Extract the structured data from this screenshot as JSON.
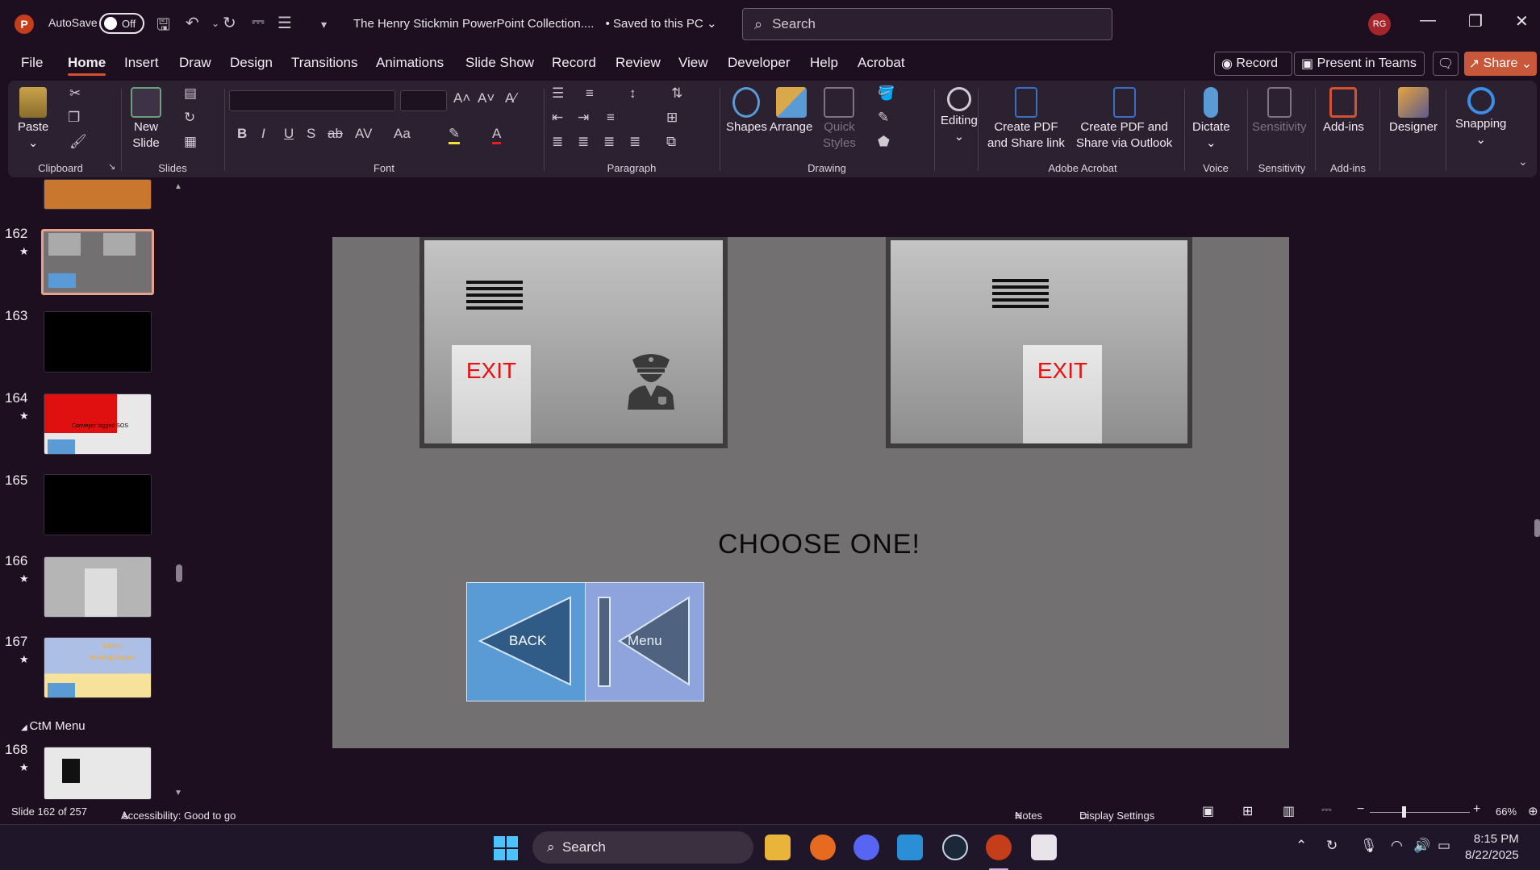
{
  "titlebar": {
    "app_icon_letter": "P",
    "autosave_label": "AutoSave",
    "autosave_state": "Off",
    "doc_title": "The Henry Stickmin PowerPoint Collection....",
    "saved_status": "• Saved to this PC",
    "search_placeholder": "Search",
    "avatar_initials": "RG"
  },
  "menu": {
    "tabs": [
      "File",
      "Home",
      "Insert",
      "Draw",
      "Design",
      "Transitions",
      "Animations",
      "Slide Show",
      "Record",
      "Review",
      "View",
      "Developer",
      "Help",
      "Acrobat"
    ],
    "active_tab": "Home",
    "record_label": "Record",
    "present_label": "Present in Teams",
    "share_label": "Share"
  },
  "ribbon": {
    "clipboard": {
      "paste": "Paste",
      "group": "Clipboard"
    },
    "slides": {
      "new_slide_1": "New",
      "new_slide_2": "Slide",
      "group": "Slides"
    },
    "font": {
      "group": "Font",
      "bold": "B",
      "italic": "I",
      "underline": "U",
      "shadow": "S",
      "strike": "ab",
      "spacing": "AV",
      "case": "Aa"
    },
    "paragraph": {
      "group": "Paragraph"
    },
    "drawing": {
      "shapes": "Shapes",
      "arrange": "Arrange",
      "quick_styles_1": "Quick",
      "quick_styles_2": "Styles",
      "group": "Drawing"
    },
    "editing": {
      "label": "Editing"
    },
    "acrobat": {
      "create_link_1": "Create PDF",
      "create_link_2": "and Share link",
      "create_outlook_1": "Create PDF and",
      "create_outlook_2": "Share via Outlook",
      "group": "Adobe Acrobat"
    },
    "voice": {
      "dictate": "Dictate",
      "group": "Voice"
    },
    "sensitivity": {
      "label": "Sensitivity",
      "group": "Sensitivity"
    },
    "addins": {
      "label": "Add-ins",
      "group": "Add-ins"
    },
    "designer": {
      "label": "Designer"
    },
    "snapping": {
      "label": "Snapping"
    }
  },
  "slide_pane": {
    "slides": [
      {
        "num": "162",
        "star": "★"
      },
      {
        "num": "163",
        "star": ""
      },
      {
        "num": "164",
        "star": "★"
      },
      {
        "num": "165",
        "star": ""
      },
      {
        "num": "166",
        "star": "★"
      },
      {
        "num": "167",
        "star": "★"
      },
      {
        "num": "168",
        "star": "★"
      }
    ],
    "thumb_164_text": "Conveyor tagged SOS",
    "thumb_167_rank": "RANK:",
    "thumb_167_title": "Venting Expert",
    "section_label": "CtM Menu"
  },
  "slide": {
    "exit_left": "EXIT",
    "exit_right": "EXIT",
    "choose": "CHOOSE ONE!",
    "back_label": "BACK",
    "menu_label": "Menu"
  },
  "status": {
    "slide_count": "Slide 162 of 257",
    "accessibility": "Accessibility: Good to go",
    "notes": "Notes",
    "display_settings": "Display Settings",
    "zoom": "66%"
  },
  "taskbar": {
    "search_placeholder": "Search",
    "time": "8:15 PM",
    "date": "8/22/2025"
  },
  "colors": {
    "accent": "#d35230",
    "app_bg": "#1d0f20",
    "ribbon_bg": "#2c2131",
    "slide_bg": "#727070",
    "exit_red": "#e81010",
    "back_blue": "#5b9bd5",
    "menu_lavender": "#8fa3dd"
  }
}
